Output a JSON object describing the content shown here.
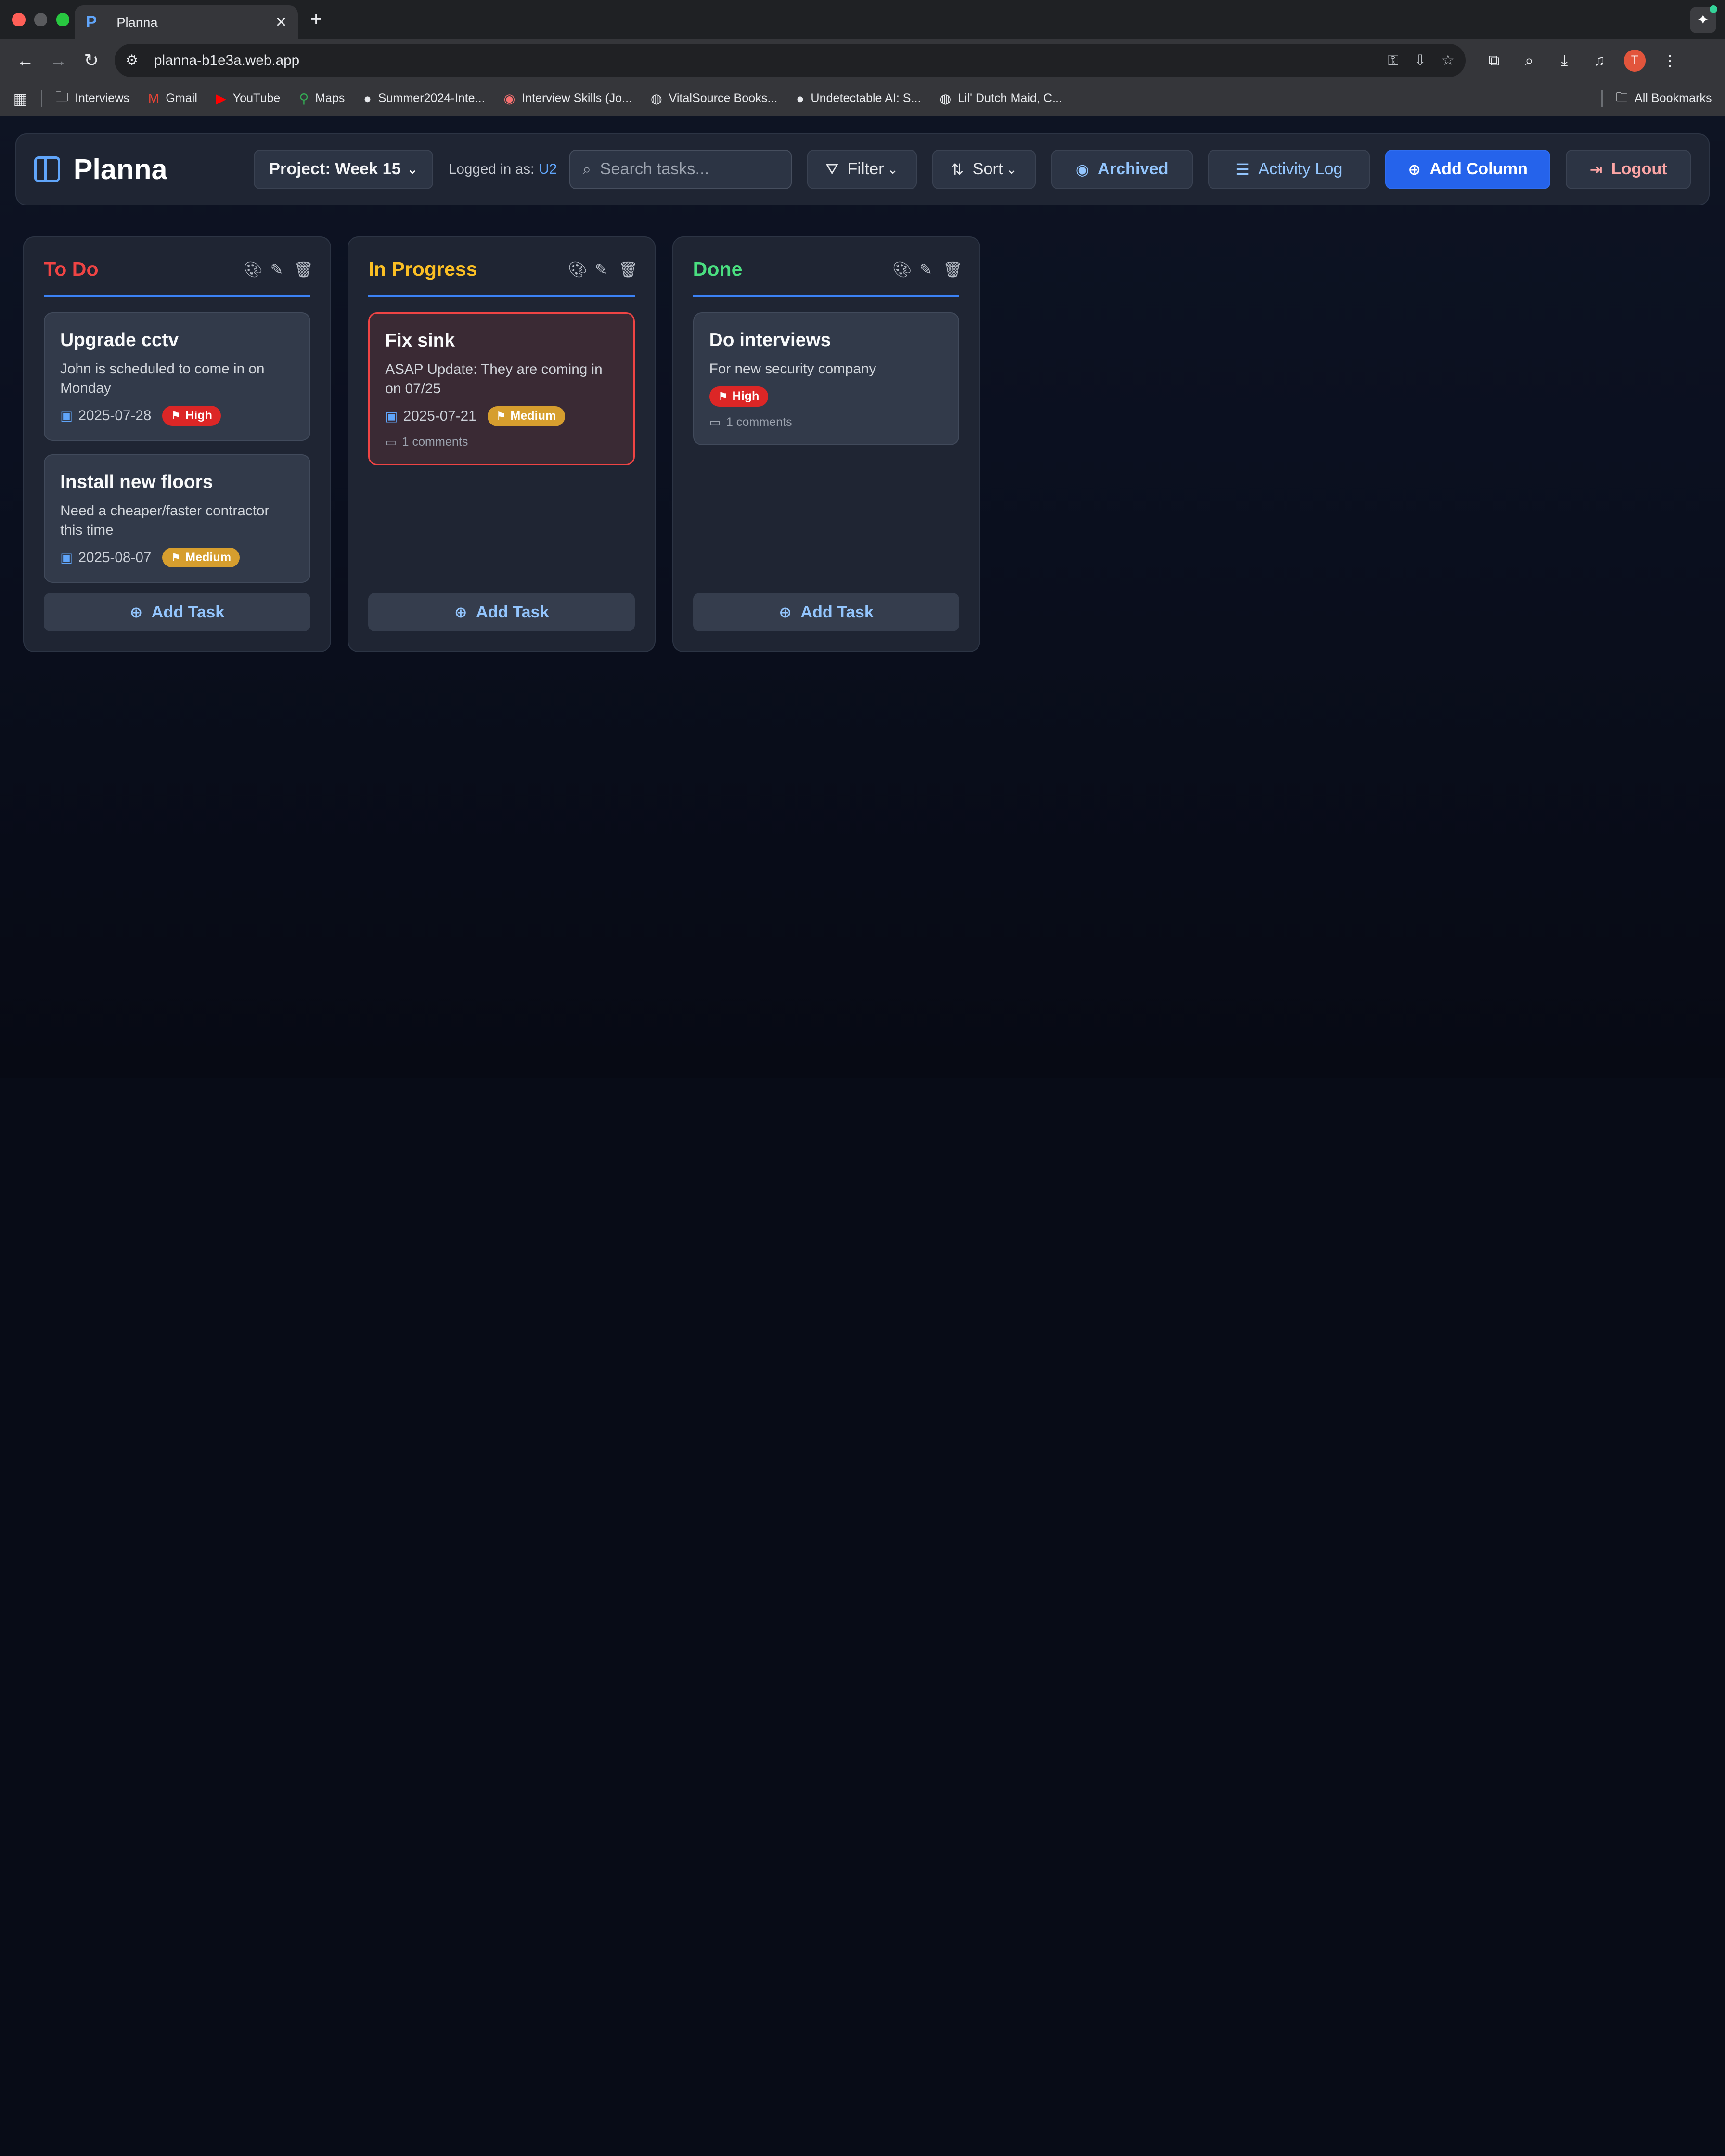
{
  "browser": {
    "tab_title": "Planna",
    "tab_favicon": "P",
    "url": "planna-b1e3a.web.app",
    "profile_initial": "T",
    "bookmarks": [
      {
        "label": "Interviews",
        "icon": "folder-icon"
      },
      {
        "label": "Gmail",
        "icon": "gmail-icon"
      },
      {
        "label": "YouTube",
        "icon": "youtube-icon"
      },
      {
        "label": "Maps",
        "icon": "maps-icon"
      },
      {
        "label": "Summer2024-Inte...",
        "icon": "github-icon"
      },
      {
        "label": "Interview Skills (Jo...",
        "icon": "site-icon"
      },
      {
        "label": "VitalSource Books...",
        "icon": "globe-icon"
      },
      {
        "label": "Undetectable AI: S...",
        "icon": "site-icon"
      },
      {
        "label": "Lil' Dutch Maid, C...",
        "icon": "globe-icon"
      }
    ],
    "all_bookmarks": "All Bookmarks"
  },
  "header": {
    "brand": "Planna",
    "project_label": "Project: Week 15",
    "logged_in_prefix": "Logged in as:",
    "logged_in_user": "U2",
    "search_placeholder": "Search tasks...",
    "filter": "Filter",
    "sort": "Sort",
    "archived": "Archived",
    "activity_log": "Activity Log",
    "add_column": "Add Column",
    "logout": "Logout"
  },
  "colors": {
    "todo": "#ef4444",
    "in_progress": "#fbbf24",
    "done": "#4ade80",
    "accent": "#2563eb"
  },
  "columns": [
    {
      "title": "To Do",
      "add_task": "Add Task",
      "cards": [
        {
          "title": "Upgrade cctv",
          "desc": "John is scheduled to come in on Monday",
          "date": "2025-07-28",
          "priority": "High"
        },
        {
          "title": "Install new floors",
          "desc": "Need a cheaper/faster contractor this time",
          "date": "2025-08-07",
          "priority": "Medium"
        }
      ]
    },
    {
      "title": "In Progress",
      "add_task": "Add Task",
      "cards": [
        {
          "title": "Fix sink",
          "desc": "ASAP Update: They are coming in on 07/25",
          "date": "2025-07-21",
          "priority": "Medium",
          "comments": "1 comments"
        }
      ]
    },
    {
      "title": "Done",
      "add_task": "Add Task",
      "cards": [
        {
          "title": "Do interviews",
          "desc": "For new security company",
          "priority": "High",
          "comments": "1 comments"
        }
      ]
    }
  ]
}
